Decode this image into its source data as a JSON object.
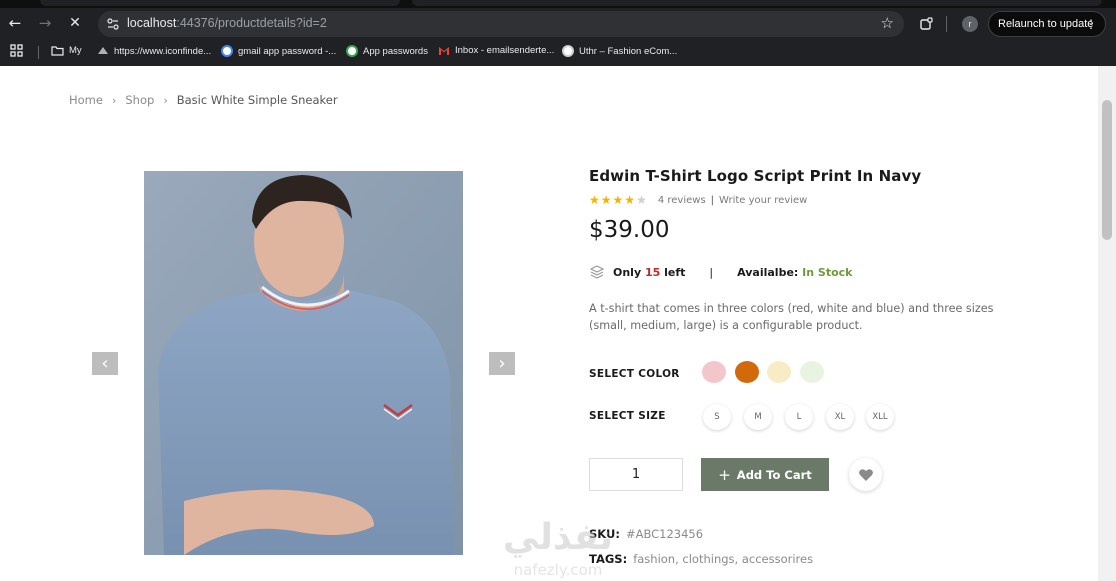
{
  "browser": {
    "url_host": "localhost",
    "url_path": ":44376/productdetails?id=2",
    "relaunch_label": "Relaunch to update",
    "profile_initial": "r",
    "bookmarks": [
      {
        "label": "My",
        "icon": "folder-icon"
      },
      {
        "label": "https://www.iconfinde...",
        "icon": "iconfinder-icon"
      },
      {
        "label": "gmail app password -...",
        "icon": "google-icon"
      },
      {
        "label": "App passwords",
        "icon": "google-icon"
      },
      {
        "label": "Inbox - emailsenderte...",
        "icon": "gmail-icon"
      },
      {
        "label": "Uthr – Fashion eCom...",
        "icon": "wordpress-icon"
      }
    ]
  },
  "breadcrumb": {
    "home": "Home",
    "shop": "Shop",
    "current": "Basic White Simple Sneaker"
  },
  "product": {
    "title": "Edwin T-Shirt Logo Script Print In Navy",
    "rating": 4,
    "rating_max": 5,
    "reviews": "4 reviews",
    "write_review": "Write your review",
    "price": "$39.00",
    "only_prefix": "Only",
    "stock_count": "15",
    "left_suffix": "left",
    "available_label": "Availalbe:",
    "available_value": "In Stock",
    "description": "A t-shirt that comes in three colors (red, white and blue) and three sizes (small, medium, large) is a configurable product.",
    "select_color_label": "SELECT COLOR",
    "colors": [
      "#f3c6cc",
      "#d26a0c",
      "#f7ecc6",
      "#e9f3e2"
    ],
    "select_size_label": "SELECT SIZE",
    "sizes": [
      "S",
      "M",
      "L",
      "XL",
      "XLL"
    ],
    "quantity": "1",
    "add_to_cart": "Add To Cart",
    "sku_label": "SKU:",
    "sku_value": "#ABC123456",
    "tags_label": "TAGS:",
    "tags_value": "fashion, clothings, accessorires"
  },
  "watermark": {
    "arabic": "نفذلي",
    "latin": "nafezly.com"
  }
}
